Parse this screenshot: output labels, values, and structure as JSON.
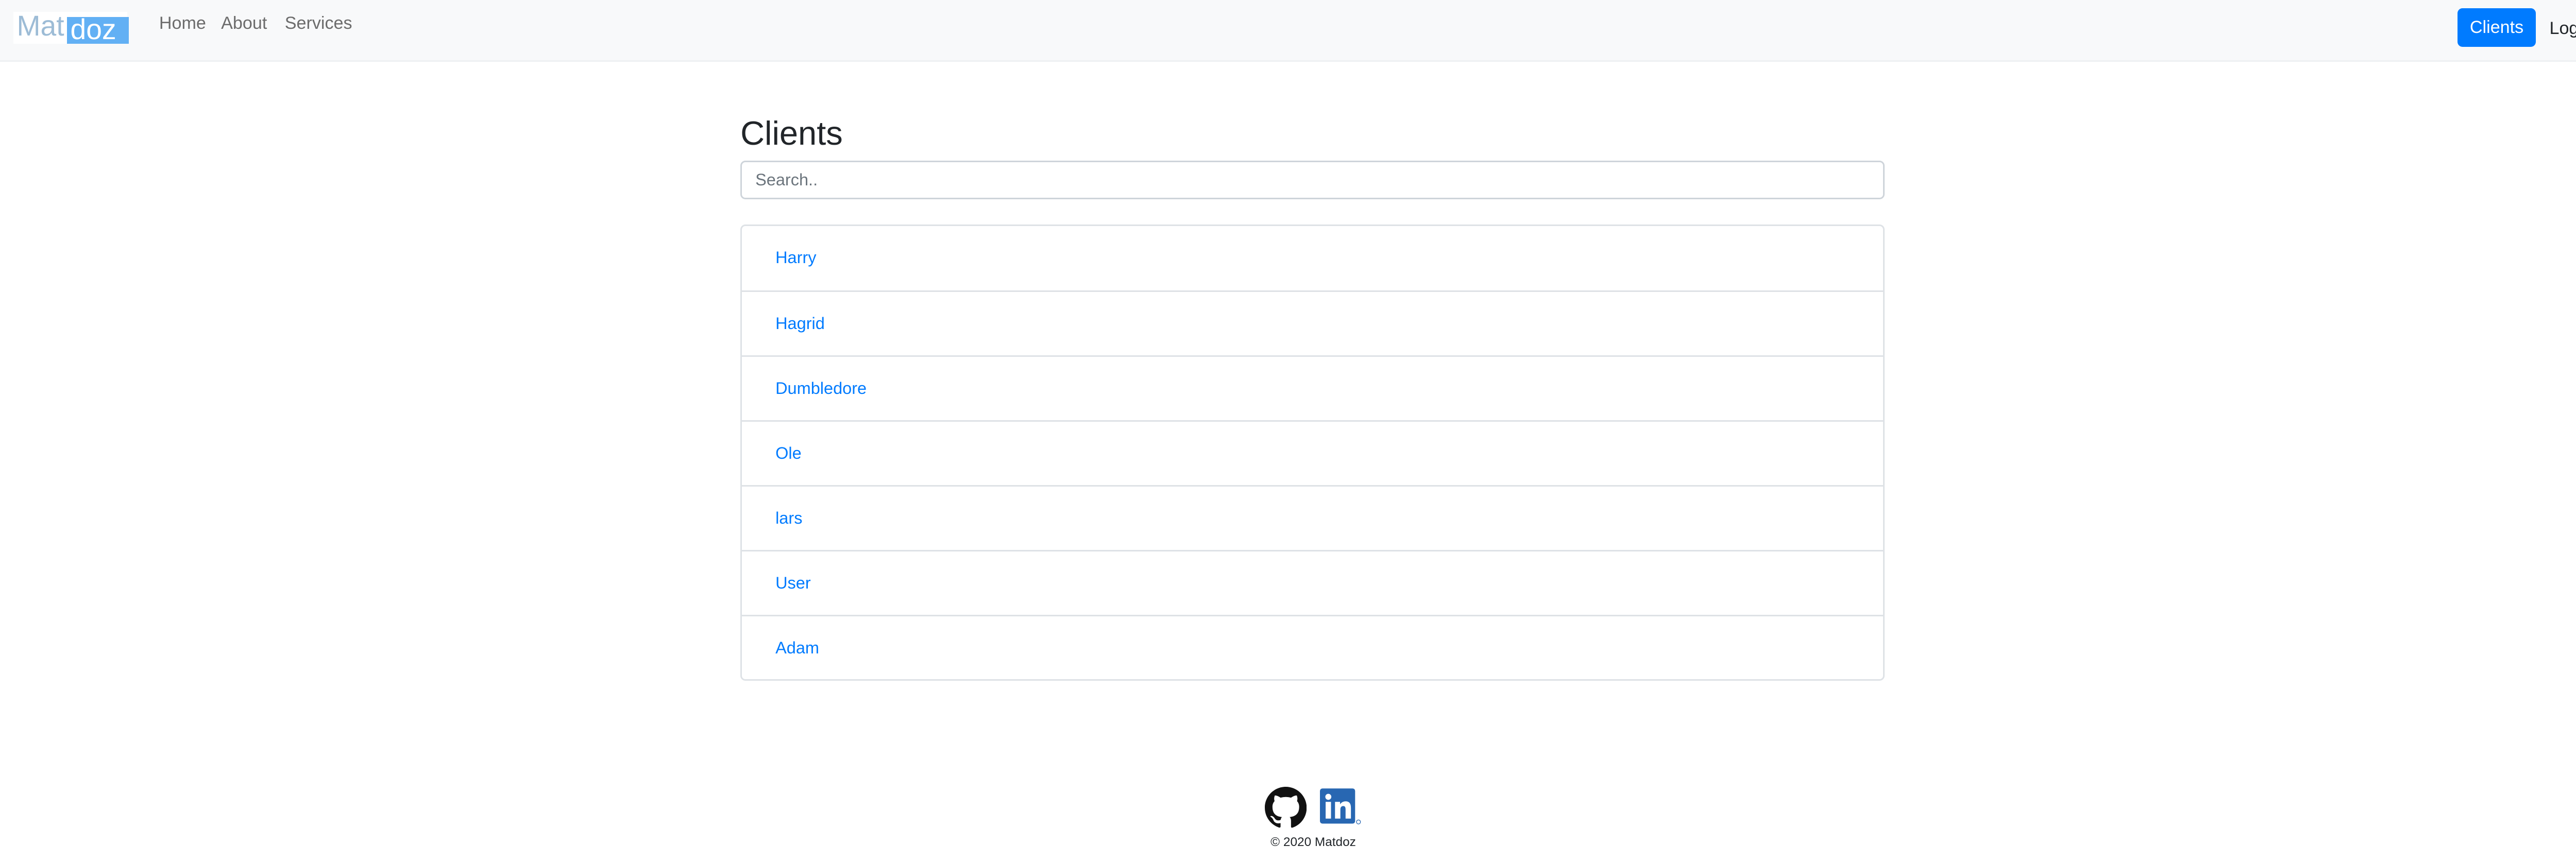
{
  "navbar": {
    "logo_part1": "Mat",
    "logo_part2": "doz",
    "links": [
      "Home",
      "About",
      "Services"
    ],
    "clients_button": "Clients",
    "logout": "Logout"
  },
  "main": {
    "title": "Clients",
    "search_placeholder": "Search..",
    "clients": [
      "Harry",
      "Hagrid",
      "Dumbledore",
      "Ole",
      "lars",
      "User",
      "Adam"
    ]
  },
  "footer": {
    "copyright": "© 2020 Matdoz",
    "icons": [
      "github-icon",
      "linkedin-icon"
    ]
  },
  "colors": {
    "accent": "#007bff",
    "navbar_bg": "#f8f9fa",
    "logo_blue": "#62b0f4"
  }
}
